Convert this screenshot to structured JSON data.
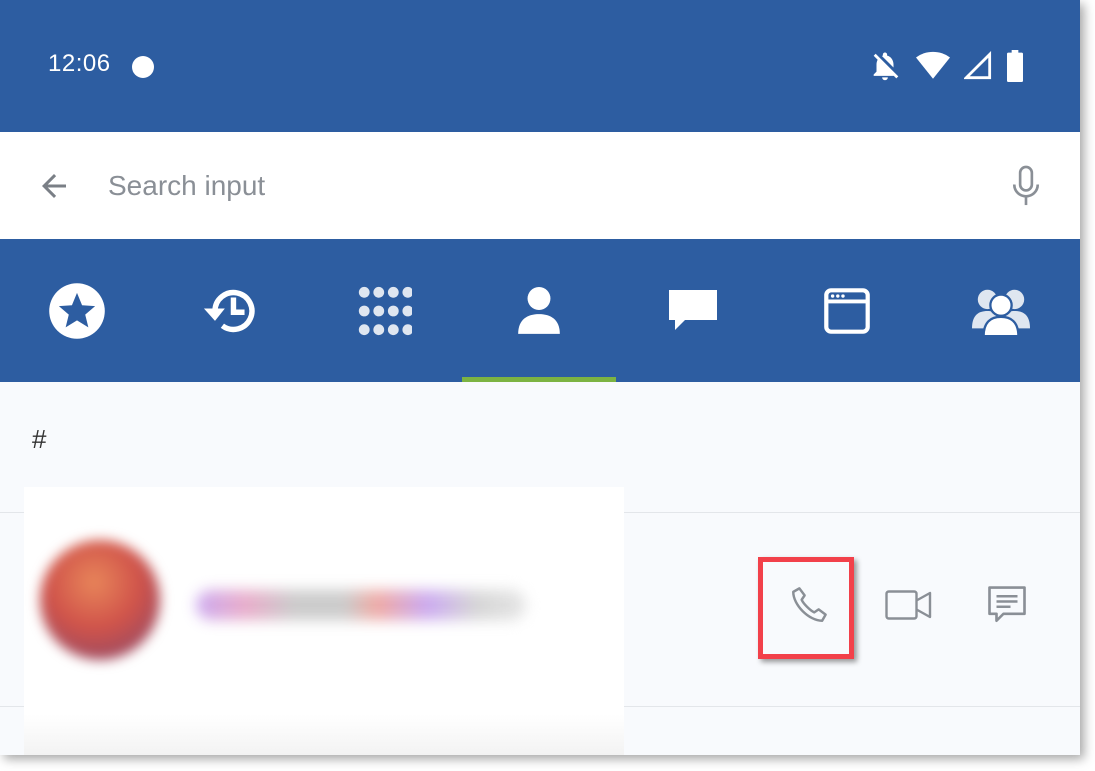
{
  "status_bar": {
    "time": "12:06",
    "icons": [
      "notification-dot-icon",
      "bell-off-icon",
      "wifi-icon",
      "signal-icon",
      "battery-icon"
    ]
  },
  "search": {
    "placeholder": "Search input",
    "icons": [
      "back-arrow-icon",
      "mic-icon"
    ]
  },
  "tabs": [
    {
      "icon": "star-icon",
      "selected": false
    },
    {
      "icon": "history-icon",
      "selected": false
    },
    {
      "icon": "dialpad-icon",
      "selected": false
    },
    {
      "icon": "contact-icon",
      "selected": true
    },
    {
      "icon": "chat-icon",
      "selected": false
    },
    {
      "icon": "browser-icon",
      "selected": false
    },
    {
      "icon": "group-icon",
      "selected": false
    }
  ],
  "section_header": "#",
  "contact_row": {
    "avatar": "blurred",
    "name": "",
    "actions": [
      "phone-icon",
      "video-icon",
      "message-icon"
    ],
    "highlighted_action": "phone-icon"
  },
  "colors": {
    "header_bg": "#2d5da1",
    "tab_indicator": "#7cb342",
    "highlight_border": "#f2404a",
    "action_icon": "#8a8f96"
  }
}
